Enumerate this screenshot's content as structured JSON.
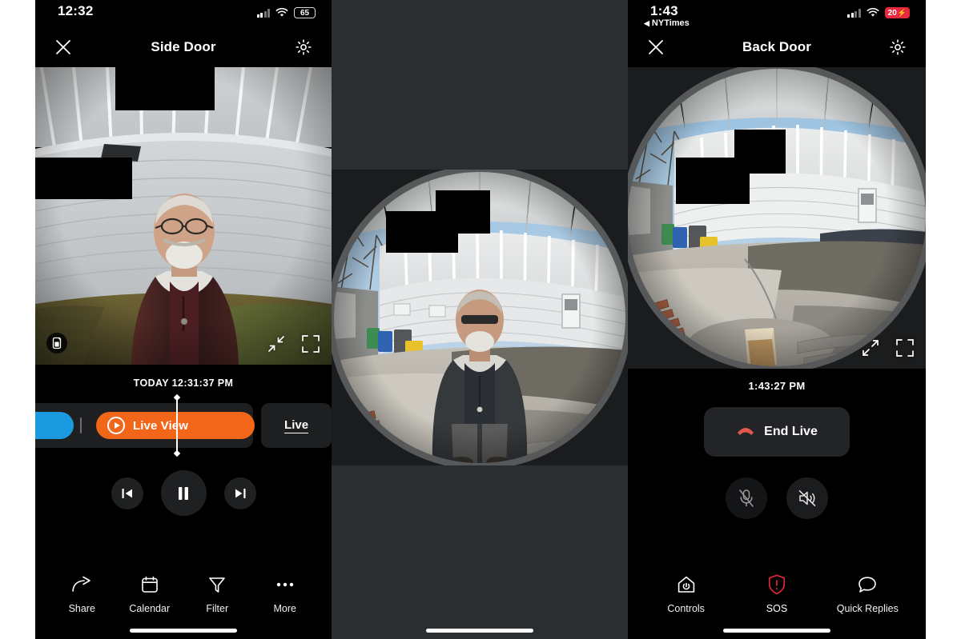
{
  "left_phone": {
    "status_bar": {
      "time": "12:32",
      "battery": "65",
      "signal_icon": "cellular-bars-icon",
      "wifi_icon": "wifi-icon",
      "battery_icon": "battery-icon"
    },
    "nav": {
      "close_label": "✕",
      "title": "Side Door",
      "settings_icon": "gear-icon",
      "close_icon": "close-icon"
    },
    "video_overlay": {
      "battery_icon": "device-battery-icon",
      "collapse_icon": "collapse-arrows-icon",
      "fullscreen_icon": "fullscreen-icon"
    },
    "playback": {
      "timestamp": "TODAY 12:31:37 PM",
      "live_view_label": "Live View",
      "live_button_label": "Live",
      "play_icon": "play-circle-icon",
      "prev_icon": "skip-previous-icon",
      "pause_icon": "pause-icon",
      "next_icon": "skip-next-icon",
      "segment_color_recorded": "#1c9ae0",
      "segment_color_live": "#f2661a"
    },
    "tabs": [
      {
        "label": "Share",
        "icon": "share-arrow-icon"
      },
      {
        "label": "Calendar",
        "icon": "calendar-icon"
      },
      {
        "label": "Filter",
        "icon": "filter-funnel-icon"
      },
      {
        "label": "More",
        "icon": "ellipsis-icon"
      }
    ]
  },
  "middle_phone": {
    "scene_description": "fisheye doorbell camera view of a man standing on a driveway next to a white sided house"
  },
  "right_phone": {
    "status_bar": {
      "time": "1:43",
      "back_app": "NYTimes",
      "back_icon": "back-triangle-icon",
      "battery": "20",
      "battery_charging": true,
      "battery_color": "#e8283c",
      "signal_icon": "cellular-bars-icon",
      "wifi_icon": "wifi-icon"
    },
    "nav": {
      "title": "Back Door",
      "settings_icon": "gear-icon",
      "close_icon": "close-icon"
    },
    "video_overlay": {
      "expand_icon": "expand-arrows-icon",
      "fullscreen_icon": "fullscreen-icon"
    },
    "live": {
      "timestamp": "1:43:27 PM",
      "end_live_label": "End Live",
      "end_live_icon": "phone-hangup-icon",
      "mic_icon": "microphone-muted-icon",
      "speaker_icon": "speaker-muted-icon",
      "mic_muted": true,
      "speaker_muted": true
    },
    "tabs": [
      {
        "label": "Controls",
        "icon": "home-power-icon"
      },
      {
        "label": "SOS",
        "icon": "shield-alert-icon"
      },
      {
        "label": "Quick Replies",
        "icon": "speech-bubble-icon"
      }
    ]
  }
}
